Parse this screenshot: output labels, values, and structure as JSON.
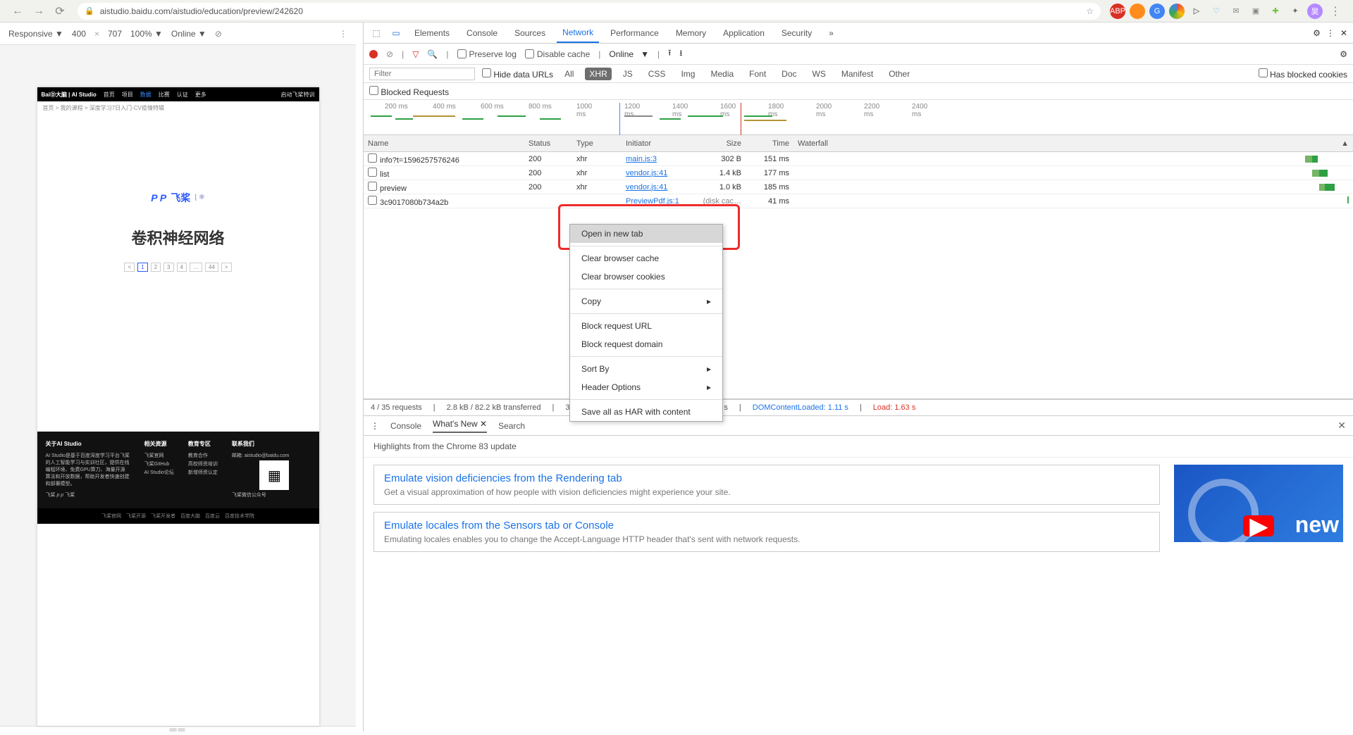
{
  "chrome": {
    "url": "aistudio.baidu.com/aistudio/education/preview/242620",
    "extensions": [
      "ABP",
      "firefox",
      "G",
      "chrome",
      "play",
      "v",
      "bird",
      "box",
      "puzzle",
      "ext",
      "avatar",
      "menu"
    ]
  },
  "device_bar": {
    "mode": "Responsive ▼",
    "w": "400",
    "x": "×",
    "h": "707",
    "zoom": "100% ▼",
    "throttle": "Online ▼"
  },
  "phone": {
    "nav": [
      "首页",
      "项目",
      "数据",
      "比赛",
      "认证",
      "更多"
    ],
    "notice": "启动飞桨特训",
    "crumb": "首页  >  我的课程  >  深度学习7日入门-CV疫情特辑",
    "logo": "飞桨",
    "logo_prefix": "P P",
    "title": "卷积神经网络",
    "pager": [
      "<",
      "1",
      "2",
      "3",
      "4",
      "…",
      "44",
      ">"
    ],
    "footer": {
      "about_h": "关于AI Studio",
      "about_1": "AI Studio是基于百度深度学习平台飞桨的人工智能学习与实训社区，提供在线编程环境、免费GPU算力、海量开源算法和开放数据，帮助开发者快速创建和部署模型。",
      "about_2": "飞桨",
      "res_h": "相关资源",
      "res_1": "飞桨官网",
      "res_2": "飞桨GitHub",
      "res_3": "AI Studio论坛",
      "edu_h": "教育专区",
      "edu_1": "教育合作",
      "edu_2": "高校师资培训",
      "edu_3": "新增师资认定",
      "contact_h": "联系我们",
      "contact_1": "邮箱: aistudio@baidu.com",
      "contact_2": "飞桨微信公众号"
    }
  },
  "devtools": {
    "tabs": [
      "Elements",
      "Console",
      "Sources",
      "Network",
      "Performance",
      "Memory",
      "Application",
      "Security"
    ],
    "active_tab": "Network",
    "netbar": {
      "preserve": "Preserve log",
      "disable": "Disable cache",
      "throttle": "Online"
    },
    "filter": {
      "placeholder": "Filter",
      "hide": "Hide data URLs",
      "types": [
        "All",
        "XHR",
        "JS",
        "CSS",
        "Img",
        "Media",
        "Font",
        "Doc",
        "WS",
        "Manifest",
        "Other"
      ],
      "active": "XHR",
      "blocked": "Has blocked cookies",
      "blocked_req": "Blocked Requests"
    },
    "timeline_ticks": [
      "200 ms",
      "400 ms",
      "600 ms",
      "800 ms",
      "1000 ms",
      "1200 ms",
      "1400 ms",
      "1600 ms",
      "1800 ms",
      "2000 ms",
      "2200 ms",
      "2400 ms"
    ],
    "columns": [
      "Name",
      "Status",
      "Type",
      "Initiator",
      "Size",
      "Time",
      "Waterfall"
    ],
    "rows": [
      {
        "name": "info?t=1596257576246",
        "status": "200",
        "type": "xhr",
        "init": "main.js:3",
        "size": "302 B",
        "time": "151 ms"
      },
      {
        "name": "list",
        "status": "200",
        "type": "xhr",
        "init": "vendor.js:41",
        "size": "1.4 kB",
        "time": "177 ms"
      },
      {
        "name": "preview",
        "status": "200",
        "type": "xhr",
        "init": "vendor.js:41",
        "size": "1.0 kB",
        "time": "185 ms"
      },
      {
        "name": "3c9017080b734a2b",
        "status": "",
        "type": "",
        "init": "PreviewPdf.js:1",
        "size": "(disk cac…",
        "time": "41 ms"
      }
    ],
    "status": {
      "reqs": "4 / 35 requests",
      "trans": "2.8 kB / 82.2 kB transferred",
      "res": "3.3 MB / 8.8 MB resources",
      "finish": "Finish: 2.05 s",
      "dom": "DOMContentLoaded: 1.11 s",
      "load": "Load: 1.63 s"
    }
  },
  "context_menu": {
    "open": "Open in new tab",
    "clear_cache": "Clear browser cache",
    "clear_cookies": "Clear browser cookies",
    "copy": "Copy",
    "block_url": "Block request URL",
    "block_domain": "Block request domain",
    "sort": "Sort By",
    "header": "Header Options",
    "save": "Save all as HAR with content"
  },
  "drawer": {
    "tabs": [
      "Console",
      "What's New",
      "Search"
    ],
    "active": "What's New",
    "close": "✕",
    "highlights": "Highlights from the Chrome 83 update",
    "cards": [
      {
        "h": "Emulate vision deficiencies from the Rendering tab",
        "p": "Get a visual approximation of how people with vision deficiencies might experience your site."
      },
      {
        "h": "Emulate locales from the Sensors tab or Console",
        "p": "Emulating locales enables you to change the Accept-Language HTTP header that's sent with network requests."
      }
    ],
    "thumb_text": "new"
  }
}
